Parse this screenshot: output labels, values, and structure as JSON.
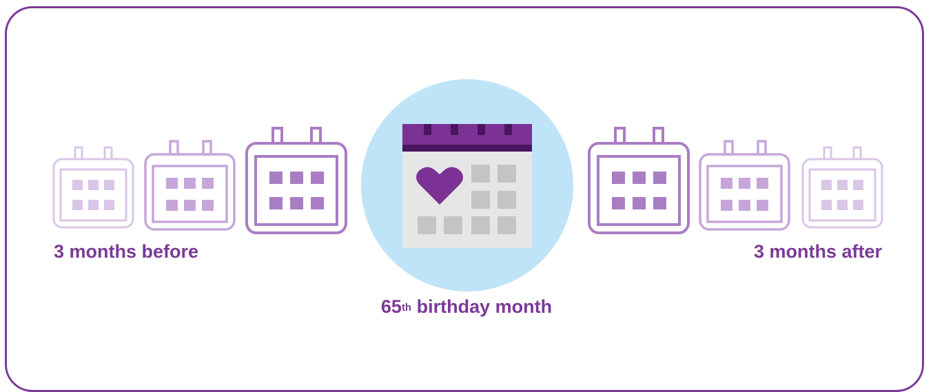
{
  "labels": {
    "before": "3 months before",
    "after": "3 months after",
    "birthday_number": "65",
    "birthday_suffix": "th",
    "birthday_rest": " birthday month"
  },
  "colors": {
    "border": "#7a3a97",
    "text": "#7a3a97",
    "circle": "#bfe3f7",
    "calendar_top": "#7b3294",
    "calendar_top_dark": "#4b1460",
    "calendar_body": "#e6e6e6",
    "calendar_cells": "#c4c4c4",
    "heart": "#7b3294",
    "outline_light": "#d5bde3",
    "outline_mid": "#c4a2d8",
    "outline_dark": "#a97dc4"
  },
  "icons": {
    "month_calendar": "calendar-icon",
    "birthday_calendar": "calendar-heart-icon"
  }
}
